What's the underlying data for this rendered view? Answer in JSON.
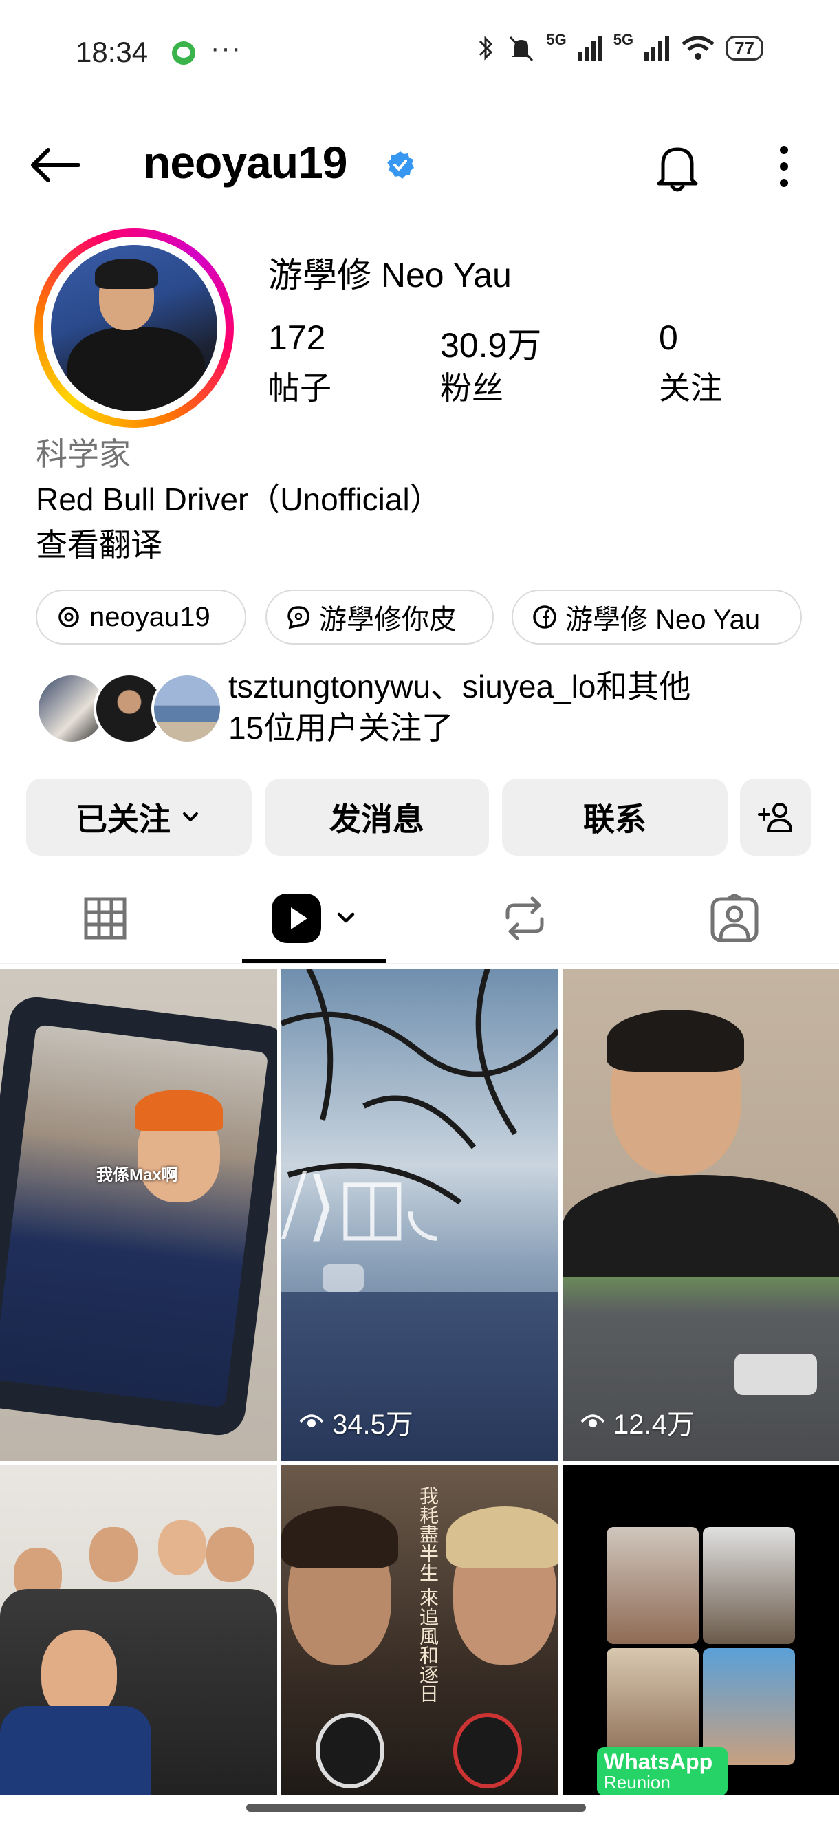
{
  "status_bar": {
    "time": "18:34",
    "dots": "···",
    "network1": "5G",
    "network2": "5G",
    "battery": "77"
  },
  "header": {
    "username": "neoyau19"
  },
  "profile": {
    "full_name": "游學修 Neo Yau",
    "stats": [
      {
        "value": "172",
        "label": "帖子"
      },
      {
        "value": "30.9万",
        "label": "粉丝"
      },
      {
        "value": "0",
        "label": "关注"
      }
    ],
    "category": "科学家",
    "bio": "Red Bull Driver（Unofficial）",
    "translate": "查看翻译"
  },
  "links": [
    {
      "label": "neoyau19",
      "icon": "threads-icon"
    },
    {
      "label": "游學修你皮",
      "icon": "threads-chat-icon"
    },
    {
      "label": "游學修 Neo Yau",
      "icon": "facebook-icon"
    }
  ],
  "followed_by": {
    "line1": "tsztungtonywu、siuyea_lo和其他",
    "line2": "15位用户关注了"
  },
  "actions": {
    "following": "已关注",
    "message": "发消息",
    "contact": "联系"
  },
  "grid": [
    {
      "views": ""
    },
    {
      "views": "34.5万"
    },
    {
      "views": "12.4万"
    },
    {
      "views": ""
    },
    {
      "views": ""
    },
    {
      "views": ""
    }
  ],
  "tiles_text": {
    "tile1_caption": "我係Max啊",
    "tile5_poster": "我耗盡半生 來追風和逐日",
    "tile6_badge1": "WhatsApp",
    "tile6_badge2": "Reunion"
  },
  "colors": {
    "verified": "#3897f0",
    "button_bg": "#efefef",
    "muted": "#737373"
  }
}
